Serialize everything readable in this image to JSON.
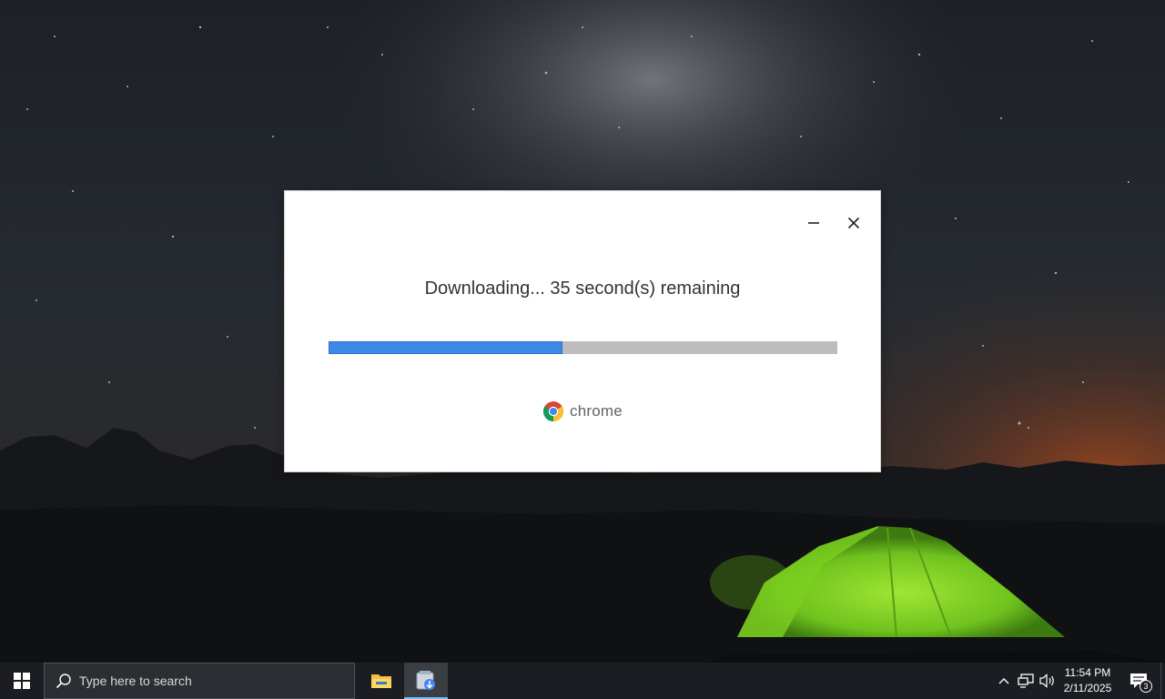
{
  "installer": {
    "status_text": "Downloading... 35 second(s) remaining",
    "progress_fraction": 0.46,
    "brand_text": "chrome",
    "minimize_icon": "minimize-icon",
    "close_icon": "close-icon",
    "colors": {
      "progress_fill": "#3c8ae6",
      "progress_track": "#bdbdbd"
    }
  },
  "taskbar": {
    "search_placeholder": "Type here to search",
    "apps": [
      {
        "name": "File Explorer",
        "icon": "folder-icon",
        "active": false
      },
      {
        "name": "Chrome Installer",
        "icon": "installer-icon",
        "active": true
      }
    ],
    "tray": {
      "icons": [
        "chevron-up-icon",
        "network-icon",
        "volume-icon"
      ],
      "time": "11:54 PM",
      "date": "2/11/2025",
      "notification_count": "3"
    }
  }
}
